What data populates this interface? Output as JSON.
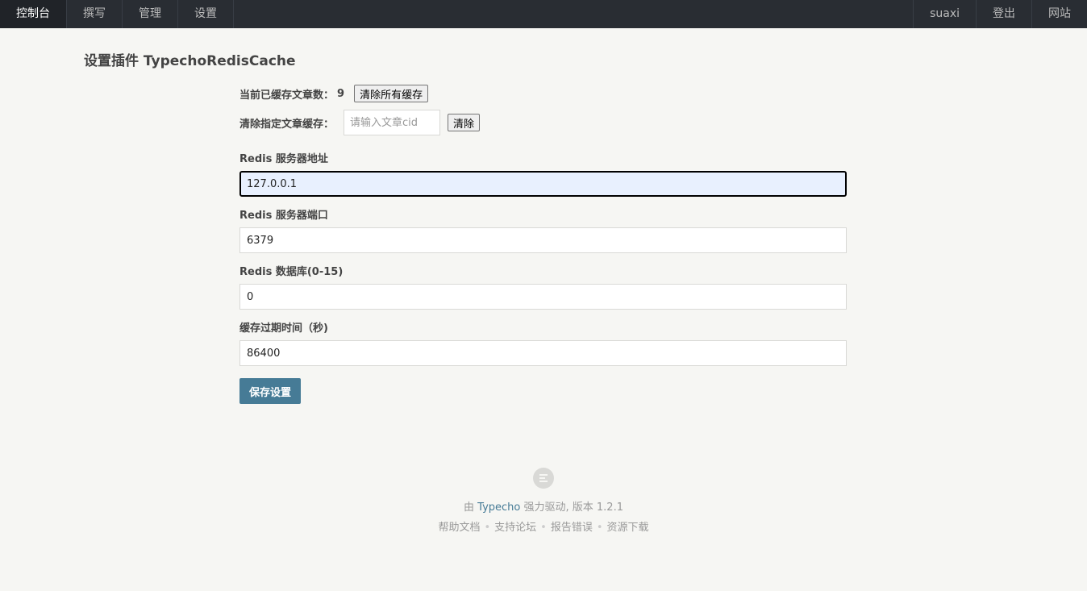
{
  "nav": {
    "left": [
      "控制台",
      "撰写",
      "管理",
      "设置"
    ],
    "right": [
      "suaxi",
      "登出",
      "网站"
    ]
  },
  "page_title": "设置插件 TypechoRedisCache",
  "cache": {
    "count_label": "当前已缓存文章数：",
    "count_value": "9",
    "clear_all_button": "清除所有缓存",
    "clear_specific_label": "清除指定文章缓存：",
    "cid_placeholder": "请输入文章cid",
    "clear_button": "清除"
  },
  "fields": [
    {
      "label": "Redis 服务器地址",
      "value": "127.0.0.1"
    },
    {
      "label": "Redis 服务器端口",
      "value": "6379"
    },
    {
      "label": "Redis 数据库(0-15)",
      "value": "0"
    },
    {
      "label": "缓存过期时间（秒)",
      "value": "86400"
    }
  ],
  "save_button": "保存设置",
  "footer": {
    "powered_prefix": "由",
    "powered_link": "Typecho",
    "powered_suffix": "强力驱动, 版本 1.2.1",
    "links": [
      "帮助文档",
      "支持论坛",
      "报告错误",
      "资源下载"
    ]
  },
  "colors": {
    "topbar": "#292d33",
    "accent": "#467b96",
    "background": "#f6f6f3"
  }
}
